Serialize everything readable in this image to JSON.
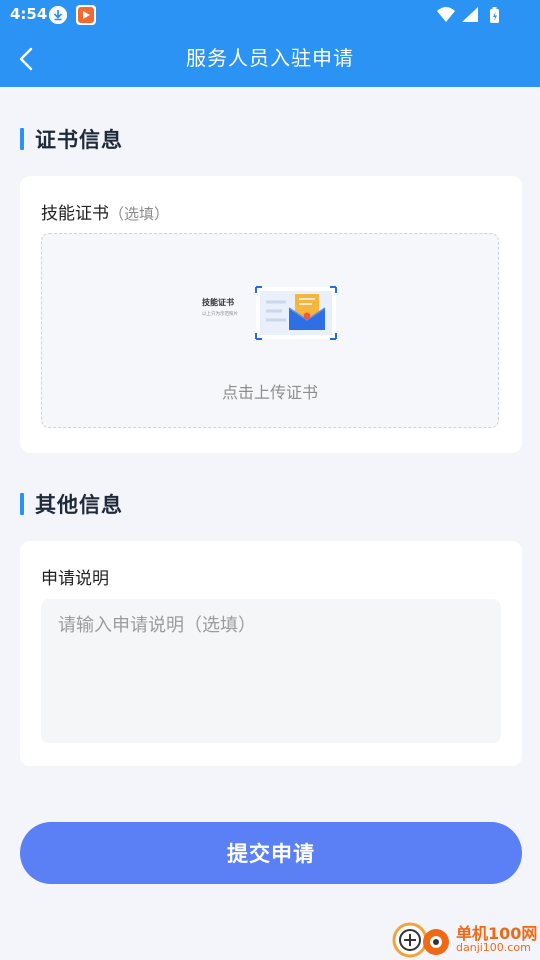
{
  "status_bar": {
    "time": "4:54",
    "icons": [
      "download-icon",
      "app-notification-icon",
      "wifi-icon",
      "signal-icon",
      "battery-icon"
    ]
  },
  "nav": {
    "title": "服务人员入驻申请",
    "back_icon": "chevron-left-icon"
  },
  "sections": {
    "certificate": {
      "title": "证书信息",
      "field_label": "技能证书",
      "field_hint": "（选填）",
      "illustration_text": "技能证书",
      "illustration_subtext": "以上只为示范照片",
      "upload_text": "点击上传证书"
    },
    "other": {
      "title": "其他信息",
      "field_label": "申请说明",
      "placeholder": "请输入申请说明（选填）"
    }
  },
  "submit": {
    "label": "提交申请"
  },
  "watermark": {
    "name": "单机100网",
    "url": "danji100.com"
  },
  "colors": {
    "primary": "#2b93f3",
    "button": "#5b7ff5",
    "background": "#f4f5fa",
    "card": "#ffffff",
    "watermark": "#ef6a17"
  }
}
